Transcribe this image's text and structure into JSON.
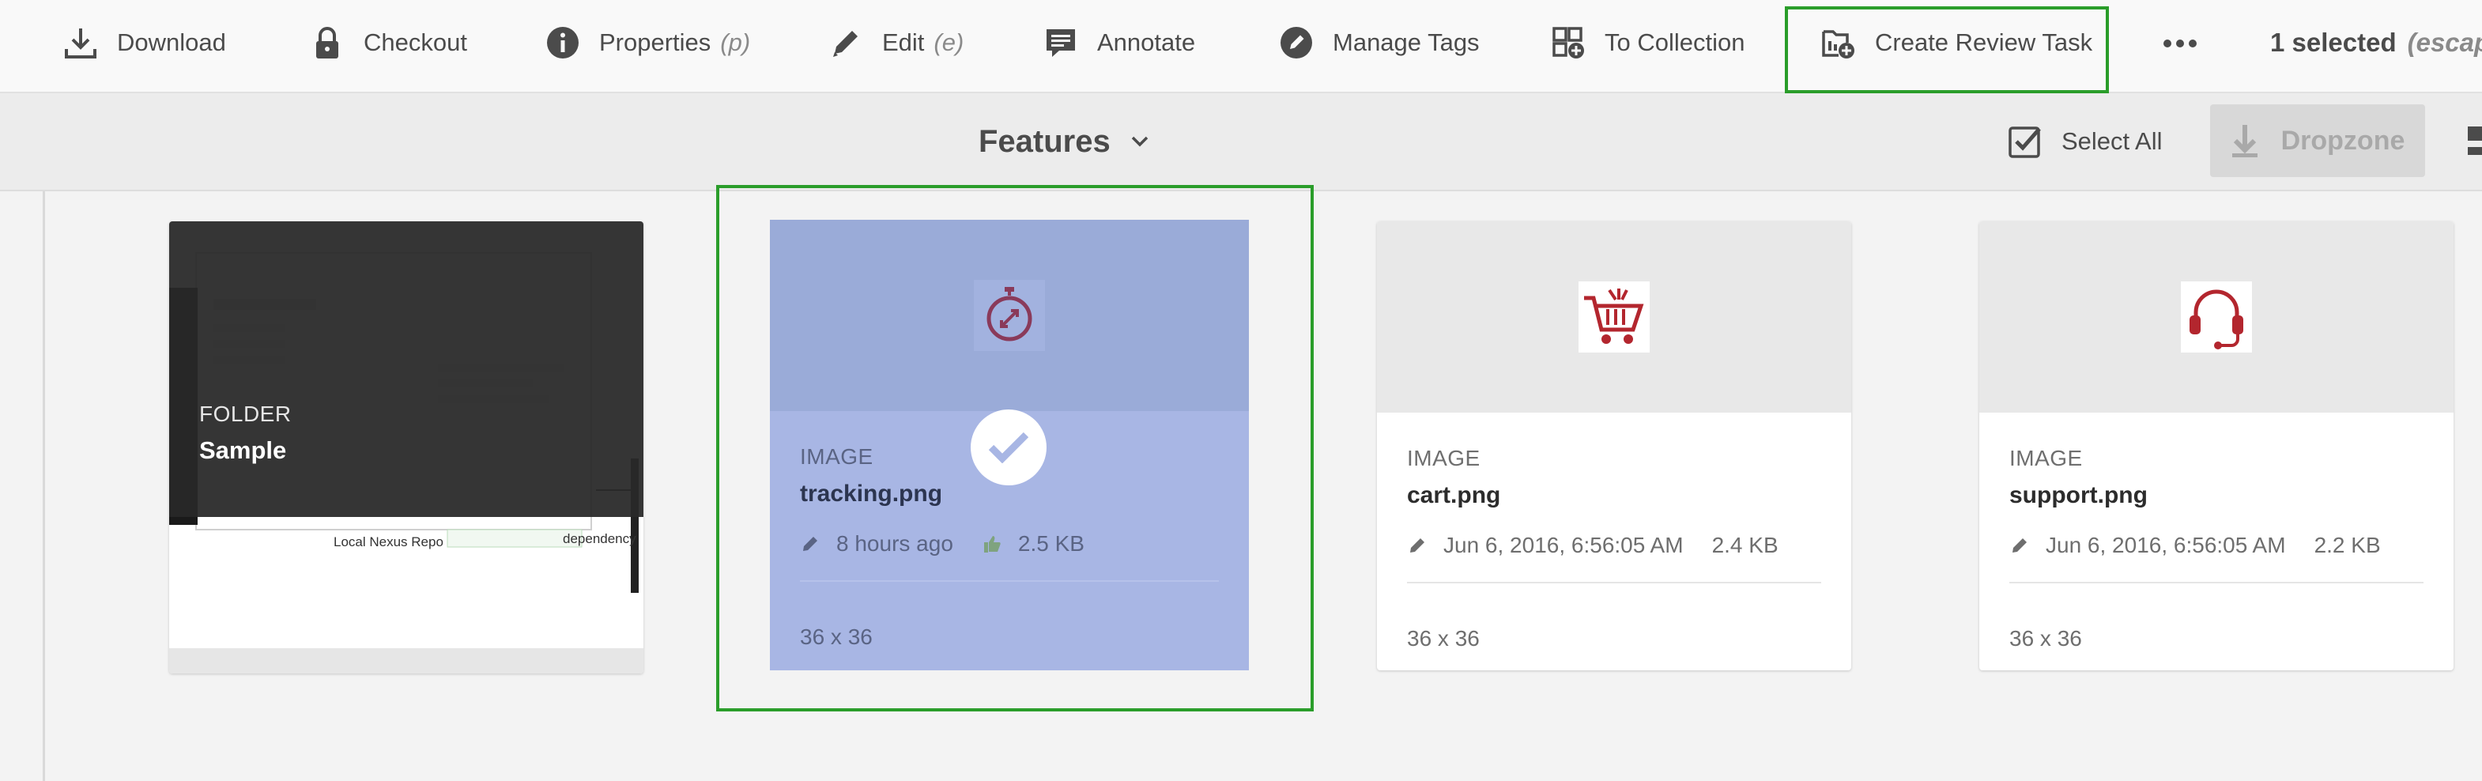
{
  "toolbar": {
    "download": "Download",
    "checkout": "Checkout",
    "properties": "Properties",
    "properties_shortcut": "(p)",
    "edit": "Edit",
    "edit_shortcut": "(e)",
    "annotate": "Annotate",
    "manage_tags": "Manage Tags",
    "to_collection": "To Collection",
    "create_review_task": "Create Review Task",
    "selected_count": "1 selected",
    "selected_hint": "(escape"
  },
  "subheader": {
    "view_title": "Features",
    "select_all": "Select All",
    "dropzone": "Dropzone"
  },
  "cards": {
    "folder": {
      "type": "FOLDER",
      "name": "Sample",
      "preview_label_1": "Local Nexus Repo",
      "preview_label_2": "dependency"
    },
    "tracking": {
      "type": "IMAGE",
      "name": "tracking.png",
      "modified": "8 hours ago",
      "size": "2.5 KB",
      "dims": "36 x 36",
      "selected": true
    },
    "cart": {
      "type": "IMAGE",
      "name": "cart.png",
      "modified": "Jun 6, 2016, 6:56:05 AM",
      "size": "2.4 KB",
      "dims": "36 x 36"
    },
    "support": {
      "type": "IMAGE",
      "name": "support.png",
      "modified": "Jun 6, 2016, 6:56:05 AM",
      "size": "2.2 KB",
      "dims": "36 x 36"
    }
  },
  "colors": {
    "highlight": "#2a9d2a",
    "selected_card": "#a8b6e4",
    "icon_red": "#b3262e"
  }
}
